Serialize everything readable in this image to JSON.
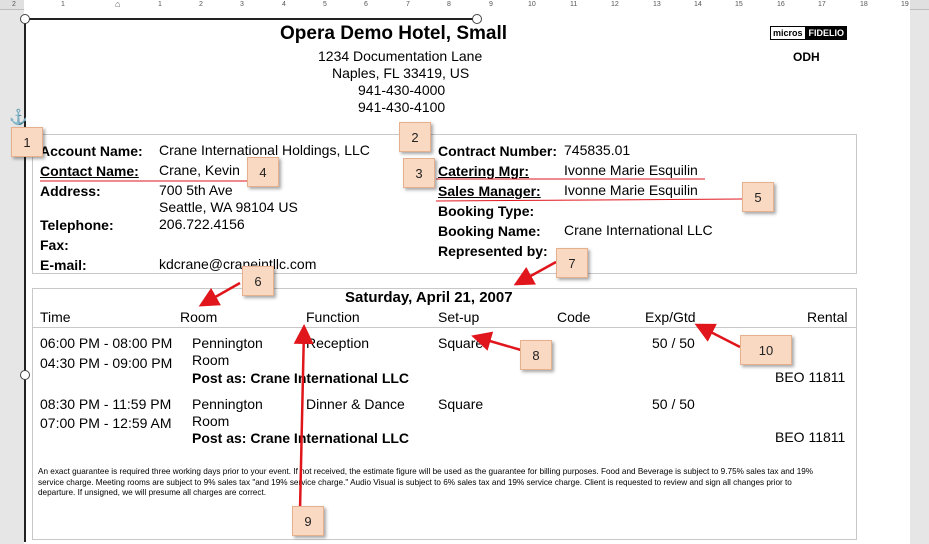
{
  "ruler": {
    "numbers": [
      "2",
      "1",
      "1",
      "2",
      "3",
      "4",
      "5",
      "6",
      "7",
      "8",
      "9",
      "10",
      "11",
      "12",
      "13",
      "14",
      "15",
      "16",
      "17",
      "18",
      "19"
    ]
  },
  "header": {
    "hotel_name": "Opera Demo Hotel, Small",
    "address1": "1234 Documentation Lane",
    "address2": "Naples, FL 33419, US",
    "phone1": "941-430-4000",
    "phone2": "941-430-4100",
    "logo_left": "micros",
    "logo_right": "FIDELIO",
    "code": "ODH"
  },
  "account": {
    "account_name_label": "Account Name:",
    "account_name": "Crane International Holdings, LLC",
    "contact_name_label": "Contact Name:",
    "contact_name": "Crane, Kevin",
    "address_label": "Address:",
    "address_line1": "700 5th Ave",
    "address_line2": "Seattle, WA  98104  US",
    "telephone_label": "Telephone:",
    "telephone": "206.722.4156",
    "fax_label": "Fax:",
    "email_label": "E-mail:",
    "email": "kdcrane@craneintllc.com"
  },
  "contract": {
    "contract_number_label": "Contract Number:",
    "contract_number": "745835.01",
    "catering_mgr_label": "Catering Mgr:",
    "catering_mgr": "Ivonne Marie Esquilin",
    "sales_manager_label": "Sales Manager:",
    "sales_manager": "Ivonne Marie Esquilin",
    "booking_type_label": "Booking Type:",
    "booking_name_label": "Booking Name:",
    "booking_name": "Crane International LLC",
    "represented_by_label": "Represented by:"
  },
  "events": {
    "date": "Saturday, April 21, 2007",
    "columns": [
      "Time",
      "Room",
      "Function",
      "Set-up",
      "Code",
      "Exp/Gtd",
      "Rental"
    ],
    "rows": [
      {
        "time1": "06:00 PM - 08:00 PM",
        "time2": "04:30 PM - 09:00 PM",
        "room1": "Pennington",
        "room2": "Room",
        "function": "Reception",
        "setup": "Square",
        "expgtd": "50 / 50",
        "post_as": "Post as: Crane International LLC",
        "beo": "BEO 11811"
      },
      {
        "time1": "08:30 PM - 11:59 PM",
        "time2": "07:00 PM - 12:59 AM",
        "room1": "Pennington",
        "room2": "Room",
        "function": "Dinner & Dance",
        "setup": "Square",
        "expgtd": "50 / 50",
        "post_as": "Post as: Crane International LLC",
        "beo": "BEO 11811"
      }
    ]
  },
  "footnote": "An exact guarantee is required three working days prior to your event. If not received, the estimate figure will be used as the guarantee for billing purposes. Food and Beverage is subject to 9.75% sales tax and 19% service charge. Meeting rooms are subject to 9% sales tax \"and 19% service charge.\" Audio Visual is subject to 6% sales tax and 19% service charge. Client is requested to review and sign all changes prior to departure. If unsigned, we will presume all charges are correct.",
  "callouts": [
    "1",
    "2",
    "3",
    "4",
    "5",
    "6",
    "7",
    "8",
    "9",
    "10"
  ],
  "colors": {
    "callout_fill": "#f9d9c2",
    "arrow": "#e0161c",
    "anchor": "#1f6fd0"
  }
}
